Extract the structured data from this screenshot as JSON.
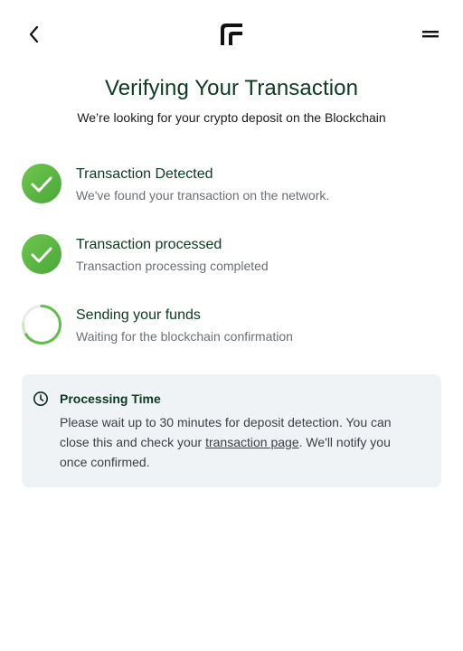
{
  "header": {
    "back_icon": "chevron-left-icon",
    "logo_icon": "brand-logo-icon",
    "menu_icon": "menu-icon"
  },
  "page": {
    "title": "Verifying Your Transaction",
    "subtitle": "We’re looking for your crypto deposit on the Blockchain"
  },
  "steps": [
    {
      "title": "Transaction Detected",
      "description": "We've found your transaction on the network.",
      "status": "complete",
      "icon": "check-circle-icon"
    },
    {
      "title": "Transaction processed",
      "description": "Transaction processing completed",
      "status": "complete",
      "icon": "check-circle-icon"
    },
    {
      "title": "Sending your funds",
      "description": "Waiting for the blockchain confirmation",
      "status": "in-progress",
      "icon": "spinner-icon"
    }
  ],
  "info": {
    "icon": "clock-icon",
    "title": "Processing Time",
    "text_before": "Please wait up to 30 minutes for deposit detection. You can close this and check your ",
    "link_text": "transaction page",
    "text_after": ". We'll notify you once confirmed."
  },
  "colors": {
    "success_green": "#6cc04a",
    "heading_green": "#0b3a22",
    "info_bg": "#f0f3f5"
  }
}
